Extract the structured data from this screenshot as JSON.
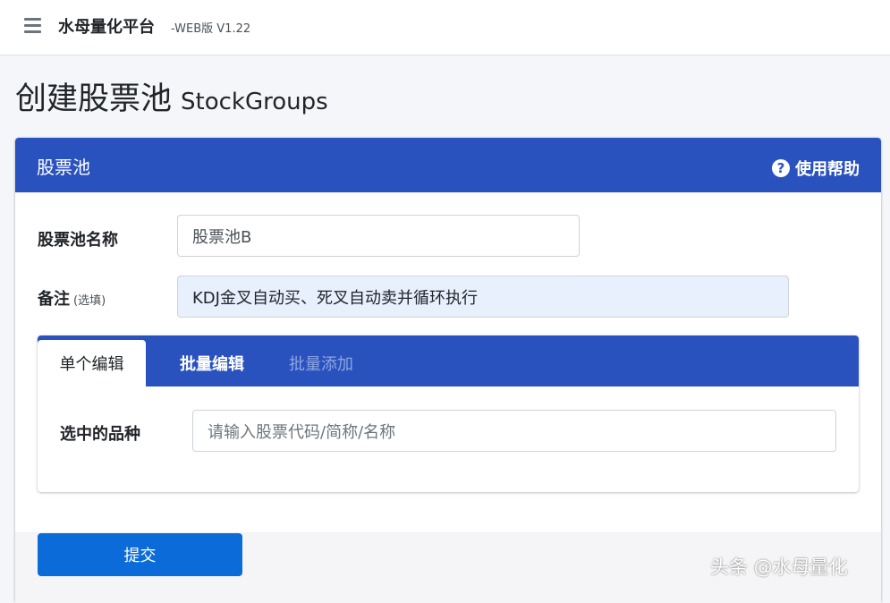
{
  "topbar": {
    "brand": "水母量化平台",
    "version": "-WEB版 V1.22"
  },
  "page": {
    "title_zh": "创建股票池",
    "title_en": "StockGroups"
  },
  "card": {
    "title": "股票池",
    "help_label": "使用帮助"
  },
  "form": {
    "name_label": "股票池名称",
    "name_value": "股票池B",
    "note_label": "备注",
    "note_optional": "(选填)",
    "note_value": "KDJ金叉自动买、死叉自动卖并循环执行"
  },
  "tabs": [
    {
      "label": "单个编辑",
      "active": true
    },
    {
      "label": "批量编辑",
      "active": false
    },
    {
      "label": "批量添加",
      "active": false
    }
  ],
  "tab_content": {
    "symbol_label": "选中的品种",
    "symbol_placeholder": "请输入股票代码/简称/名称"
  },
  "footer": {
    "submit_label": "提交"
  },
  "watermark": "头条 @水母量化",
  "colors": {
    "header_blue": "#2a52be",
    "submit_blue": "#0b6bd8",
    "filled_input_bg": "#e8f0fe"
  }
}
